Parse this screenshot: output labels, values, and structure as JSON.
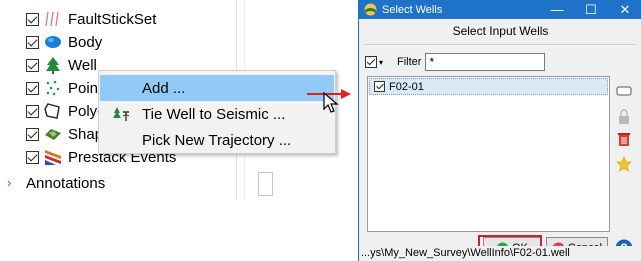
{
  "tree": {
    "items": [
      {
        "label": "FaultStickSet",
        "icon": "fault-stick-icon"
      },
      {
        "label": "Body",
        "icon": "body-icon"
      },
      {
        "label": "Well",
        "icon": "well-tree-icon"
      },
      {
        "label": "Point",
        "icon": "pointset-icon"
      },
      {
        "label": "Polyg",
        "icon": "polygon-icon"
      },
      {
        "label": "Shap",
        "icon": "shape-icon"
      },
      {
        "label": "Prestack Events",
        "icon": "prestack-icon"
      }
    ],
    "annotations_label": "Annotations"
  },
  "context_menu": {
    "items": [
      {
        "label": "Add ...",
        "highlighted": true
      },
      {
        "label": "Tie Well to Seismic ...",
        "highlighted": false
      },
      {
        "label": "Pick New Trajectory ...",
        "highlighted": false
      }
    ]
  },
  "dialog": {
    "title": "Select Wells",
    "header": "Select Input Wells",
    "filter_label": "Filter",
    "filter_value": "*",
    "wells": [
      {
        "name": "F02-01",
        "checked": true
      }
    ],
    "ok_label": "OK",
    "cancel_label": "Cancel",
    "status_path": "...ys\\My_New_Survey\\WellInfo\\F02-01.well",
    "colors": {
      "titlebar": "#1e73c8",
      "highlight_outline": "#d4202a",
      "arrow": "#e02020"
    }
  }
}
